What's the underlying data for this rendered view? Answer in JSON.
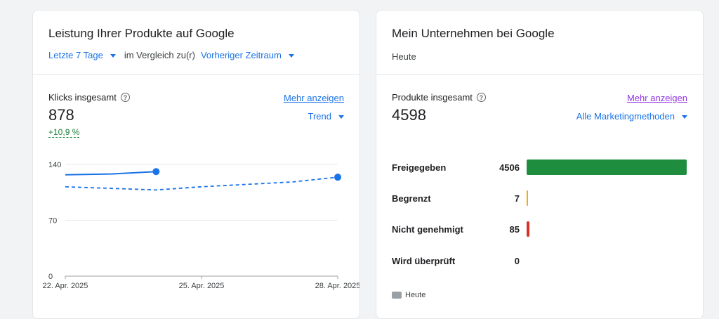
{
  "left_card": {
    "title": "Leistung Ihrer Produkte auf Google",
    "period_dropdown": "Letzte 7 Tage",
    "compare_text": "im Vergleich zu(r)",
    "compare_dropdown": "Vorheriger Zeitraum",
    "metric_label": "Klicks insgesamt",
    "metric_value": "878",
    "delta": "+10,9 %",
    "more_link": "Mehr anzeigen",
    "view_dropdown": "Trend"
  },
  "right_card": {
    "title": "Mein Unternehmen bei Google",
    "subtitle": "Heute",
    "metric_label": "Produkte insgesamt",
    "metric_value": "4598",
    "more_link": "Mehr anzeigen",
    "filter_dropdown": "Alle Marketingmethoden",
    "legend": "Heute"
  },
  "colors": {
    "current_line": "#1a73e8",
    "previous_line": "#1a73e8",
    "approved": "#1e8e3e",
    "limited": "#f9ab00",
    "rejected": "#d93025"
  },
  "chart_data": [
    {
      "type": "line",
      "x": [
        "22. Apr. 2025",
        "23. Apr. 2025",
        "24. Apr. 2025",
        "25. Apr. 2025",
        "26. Apr. 2025",
        "27. Apr. 2025",
        "28. Apr. 2025"
      ],
      "x_tick_labels": [
        "22. Apr. 2025",
        "25. Apr. 2025",
        "28. Apr. 2025"
      ],
      "ylim": [
        0,
        140
      ],
      "y_ticks": [
        0,
        70,
        140
      ],
      "grid": true,
      "series": [
        {
          "values": [
            127,
            128,
            131,
            null,
            null,
            null,
            124
          ],
          "style": "solid"
        },
        {
          "values": [
            112,
            110,
            108,
            112,
            115,
            118,
            124
          ],
          "style": "dashed"
        }
      ]
    },
    {
      "type": "bar",
      "orientation": "horizontal",
      "categories": [
        "Freigegeben",
        "Begrenzt",
        "Nicht genehmigt",
        "Wird überprüft"
      ],
      "values": [
        4506,
        7,
        85,
        0
      ],
      "xlim": [
        0,
        4506
      ]
    }
  ]
}
